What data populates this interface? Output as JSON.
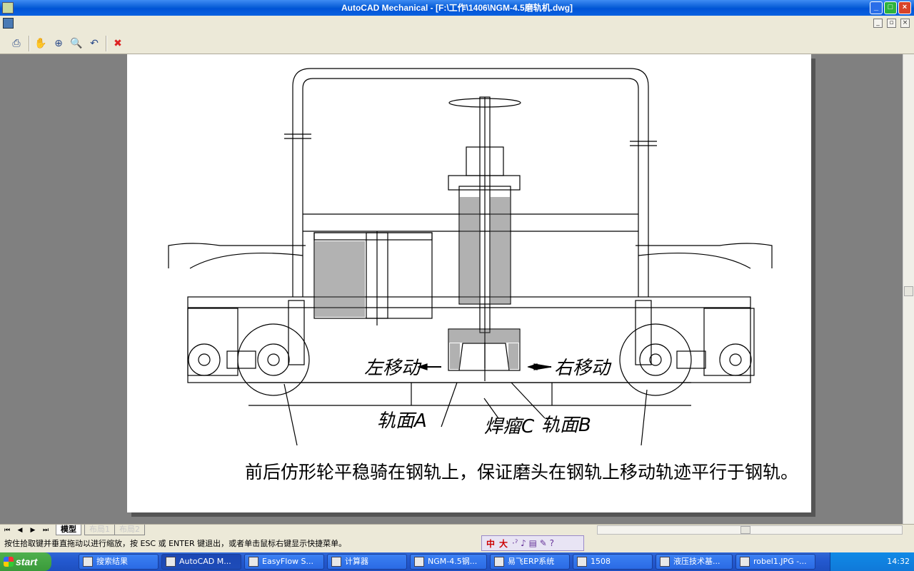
{
  "window": {
    "title": "AutoCAD Mechanical - [F:\\工作\\1406\\NGM-4.5磨轨机.dwg]",
    "min": "_",
    "max": "□",
    "close": "×"
  },
  "mdi": {
    "min": "_",
    "restore": "▫",
    "close": "×"
  },
  "toolbar": {
    "plot": "⎙",
    "pan": "✋",
    "zoom_realtime": "⊕",
    "zoom_window": "🔍",
    "zoom_previous": "↶",
    "close_preview": "✖"
  },
  "drawing": {
    "label_left_move": "左移动",
    "label_right_move": "右移动",
    "label_rail_a": "轨面A",
    "label_weld_c": "焊瘤C",
    "label_rail_b": "轨面B",
    "caption": "前后仿形轮平稳骑在钢轨上，保证磨头在钢轨上移动轨迹平行于钢轨。"
  },
  "layout_tabs": {
    "nav_first": "⏮",
    "nav_prev": "◀",
    "nav_next": "▶",
    "nav_last": "⏭",
    "model": "模型",
    "layout1": "布局1",
    "layout2": "布局2"
  },
  "status": {
    "prompt": "按住拾取键并垂直拖动以进行缩放，按 ESC 或 ENTER 键退出，或者单击鼠标右键显示快捷菜单。"
  },
  "ime": {
    "zhong": "中",
    "da": "大",
    "extra": "·ˀ ♪ ▤ ✎ ?"
  },
  "taskbar": {
    "start": "start",
    "items": [
      {
        "label": "搜索结果",
        "icon": "search"
      },
      {
        "label": "AutoCAD M...",
        "icon": "autocad"
      },
      {
        "label": "EasyFlow S...",
        "icon": "ie"
      },
      {
        "label": "计算器",
        "icon": "calc"
      },
      {
        "label": "NGM-4.5钢...",
        "icon": "word"
      },
      {
        "label": "易飞ERP系统",
        "icon": "erp"
      },
      {
        "label": "1508",
        "icon": "folder"
      },
      {
        "label": "液压技术基...",
        "icon": "ppt"
      },
      {
        "label": "robel1.JPG -...",
        "icon": "image"
      }
    ],
    "clock": "14:32"
  }
}
